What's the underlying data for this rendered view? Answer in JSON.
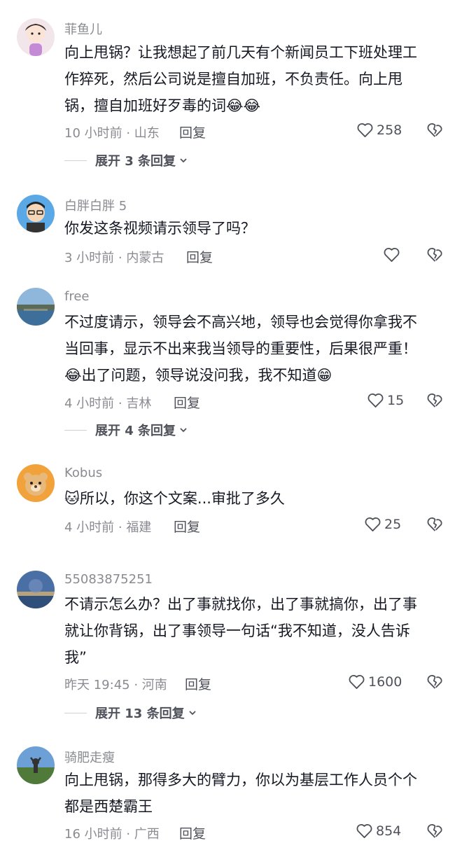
{
  "comments": [
    {
      "username": "菲鱼儿",
      "lines": [
        "向上甩锅？让我想起了前几天有个新闻员工下班处理工",
        "作猝死，然后公司说是擅自加班，不负责任。向上甩",
        "锅，擅自加班好歹毒的词😂😂"
      ],
      "meta": "10 小时前 · 山东",
      "reply_label": "回复",
      "likes": "258",
      "expand": "展开 3 条回复"
    },
    {
      "username": "白胖白胖 5",
      "lines": [
        "你发这条视频请示领导了吗？"
      ],
      "meta": "3 小时前 · 内蒙古",
      "reply_label": "回复",
      "likes": ""
    },
    {
      "username": "free",
      "lines": [
        "不过度请示，领导会不高兴地，领导也会觉得你拿我不",
        "当回事，显示不出来我当领导的重要性，后果很严重！",
        "😂出了问题，领导说没问我，我不知道😁"
      ],
      "meta": "4 小时前 · 吉林",
      "reply_label": "回复",
      "likes": "15",
      "expand": "展开 4 条回复"
    },
    {
      "username": "Kobus",
      "lines": [
        "🐱所以，你这个文案...审批了多久"
      ],
      "meta": "4 小时前 · 福建",
      "reply_label": "回复",
      "likes": "25"
    },
    {
      "username": "55083875251",
      "lines": [
        "不请示怎么办？出了事就找你，出了事就搞你，出了事",
        "就让你背锅，出了事领导一句话“我不知道，没人告诉",
        "我”"
      ],
      "meta": "昨天 19:45 · 河南",
      "reply_label": "回复",
      "likes": "1600",
      "expand": "展开 13 条回复"
    },
    {
      "username": "骑肥走瘦",
      "lines": [
        "向上甩锅，那得多大的臂力，你以为基层工作人员个个",
        "都是西楚霸王"
      ],
      "meta": "16 小时前 · 广西",
      "reply_label": "回复",
      "likes": "854"
    }
  ],
  "icons": {
    "like": "heart-outline-icon",
    "dislike": "broken-heart-icon",
    "expand": "chevron-down-icon"
  },
  "colors": {
    "text": "#161823",
    "secondary": "#8a8b91",
    "action": "#50525b"
  }
}
